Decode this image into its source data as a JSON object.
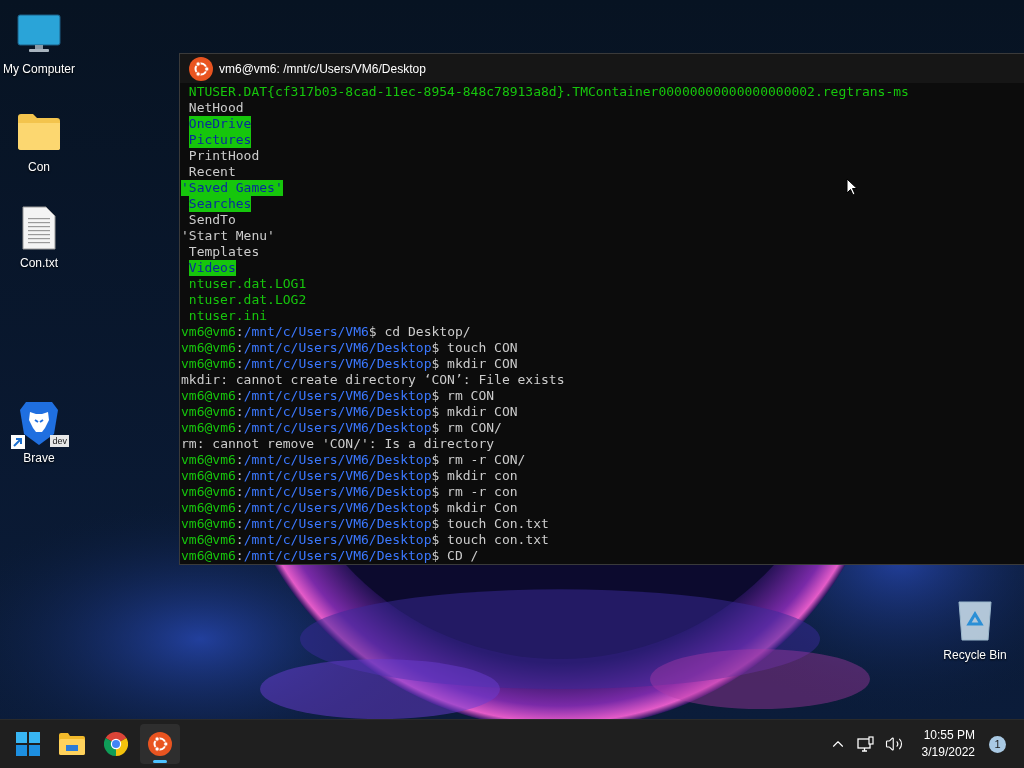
{
  "desktop": {
    "icons": [
      {
        "label": "My Computer",
        "kind": "computer",
        "shortcut": false
      },
      {
        "label": "Con",
        "kind": "folder",
        "shortcut": false
      },
      {
        "label": "Con.txt",
        "kind": "text-file",
        "shortcut": false
      },
      {
        "label": "Brave",
        "kind": "brave",
        "badge": "dev",
        "shortcut": true
      },
      {
        "label": "Recycle Bin",
        "kind": "recycle-bin",
        "shortcut": false
      }
    ]
  },
  "terminal": {
    "title": "vm6@vm6: /mnt/c/Users/VM6/Desktop",
    "lines": [
      {
        "kind": "file",
        "text": "NTUSER.DAT{cf317b03-8cad-11ec-8954-848c78913a8d}.TMContainer00000000000000000002.regtrans-ms",
        "quoted": false
      },
      {
        "kind": "plain",
        "text": "NetHood",
        "quoted": false
      },
      {
        "kind": "sticky",
        "text": "OneDrive",
        "quoted": false
      },
      {
        "kind": "sticky",
        "text": "Pictures",
        "quoted": false
      },
      {
        "kind": "plain",
        "text": "PrintHood",
        "quoted": false
      },
      {
        "kind": "plain",
        "text": "Recent",
        "quoted": false
      },
      {
        "kind": "sticky",
        "text": "'Saved Games'",
        "quoted": true
      },
      {
        "kind": "sticky",
        "text": "Searches",
        "quoted": false
      },
      {
        "kind": "plain",
        "text": "SendTo",
        "quoted": false
      },
      {
        "kind": "plain",
        "text": "'Start Menu'",
        "quoted": true
      },
      {
        "kind": "plain",
        "text": "Templates",
        "quoted": false
      },
      {
        "kind": "sticky",
        "text": "Videos",
        "quoted": false
      },
      {
        "kind": "file",
        "text": "ntuser.dat.LOG1",
        "quoted": false
      },
      {
        "kind": "file",
        "text": "ntuser.dat.LOG2",
        "quoted": false
      },
      {
        "kind": "file",
        "text": "ntuser.ini",
        "quoted": false
      },
      {
        "kind": "prompt",
        "user": "vm6@vm6",
        "separator": ":",
        "path": "/mnt/c/Users/VM6",
        "command": "$ cd Desktop/"
      },
      {
        "kind": "prompt",
        "user": "vm6@vm6",
        "separator": ":",
        "path": "/mnt/c/Users/VM6/Desktop",
        "command": "$ touch CON"
      },
      {
        "kind": "prompt",
        "user": "vm6@vm6",
        "separator": ":",
        "path": "/mnt/c/Users/VM6/Desktop",
        "command": "$ mkdir CON"
      },
      {
        "kind": "output",
        "text": "mkdir: cannot create directory ‘CON’: File exists"
      },
      {
        "kind": "prompt",
        "user": "vm6@vm6",
        "separator": ":",
        "path": "/mnt/c/Users/VM6/Desktop",
        "command": "$ rm CON"
      },
      {
        "kind": "prompt",
        "user": "vm6@vm6",
        "separator": ":",
        "path": "/mnt/c/Users/VM6/Desktop",
        "command": "$ mkdir CON"
      },
      {
        "kind": "prompt",
        "user": "vm6@vm6",
        "separator": ":",
        "path": "/mnt/c/Users/VM6/Desktop",
        "command": "$ rm CON/"
      },
      {
        "kind": "output",
        "text": "rm: cannot remove 'CON/': Is a directory"
      },
      {
        "kind": "prompt",
        "user": "vm6@vm6",
        "separator": ":",
        "path": "/mnt/c/Users/VM6/Desktop",
        "command": "$ rm -r CON/"
      },
      {
        "kind": "prompt",
        "user": "vm6@vm6",
        "separator": ":",
        "path": "/mnt/c/Users/VM6/Desktop",
        "command": "$ mkdir con"
      },
      {
        "kind": "prompt",
        "user": "vm6@vm6",
        "separator": ":",
        "path": "/mnt/c/Users/VM6/Desktop",
        "command": "$ rm -r con"
      },
      {
        "kind": "prompt",
        "user": "vm6@vm6",
        "separator": ":",
        "path": "/mnt/c/Users/VM6/Desktop",
        "command": "$ mkdir Con"
      },
      {
        "kind": "prompt",
        "user": "vm6@vm6",
        "separator": ":",
        "path": "/mnt/c/Users/VM6/Desktop",
        "command": "$ touch Con.txt"
      },
      {
        "kind": "prompt",
        "user": "vm6@vm6",
        "separator": ":",
        "path": "/mnt/c/Users/VM6/Desktop",
        "command": "$ touch con.txt"
      },
      {
        "kind": "prompt",
        "user": "vm6@vm6",
        "separator": ":",
        "path": "/mnt/c/Users/VM6/Desktop",
        "command": "$ CD /"
      }
    ]
  },
  "taskbar": {
    "apps": [
      {
        "kind": "start",
        "selected": false
      },
      {
        "kind": "file-explorer",
        "selected": false
      },
      {
        "kind": "chrome",
        "selected": false
      },
      {
        "kind": "ubuntu",
        "selected": true
      }
    ],
    "tray": {
      "time": "10:55 PM",
      "date": "3/19/2022",
      "notifications": "1"
    }
  }
}
